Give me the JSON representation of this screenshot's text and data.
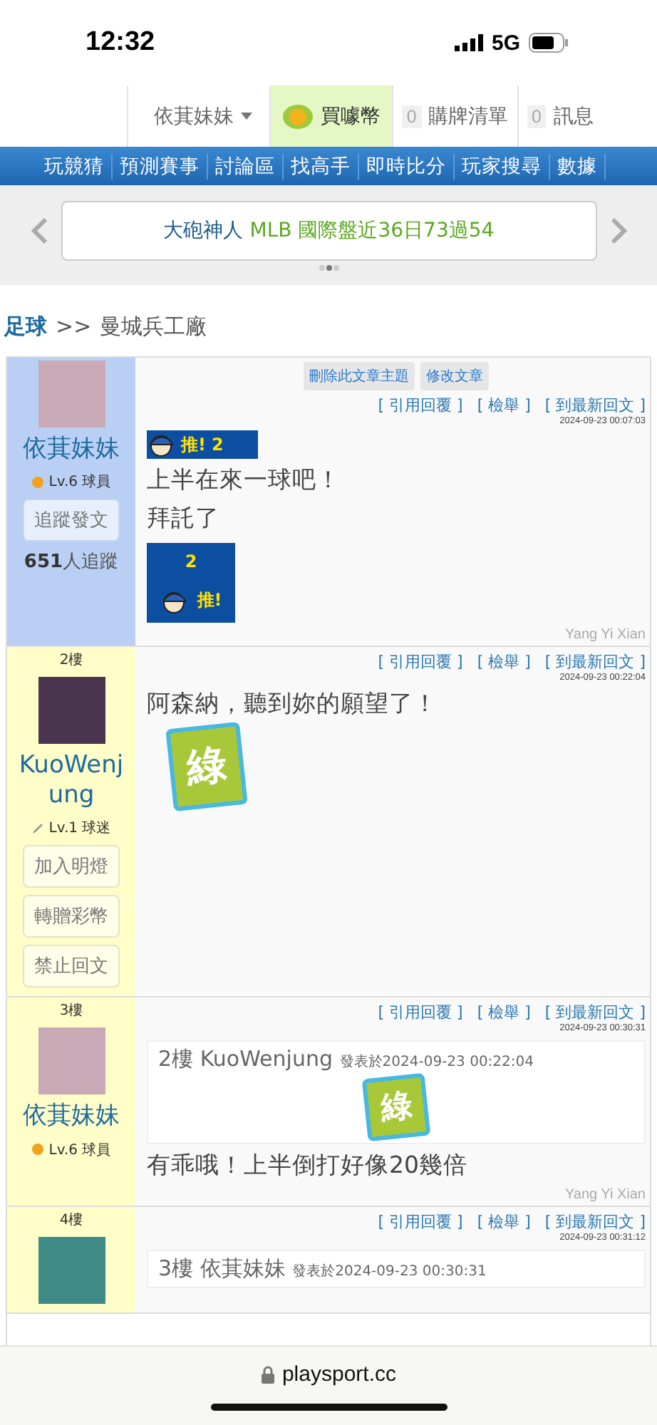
{
  "status_bar": {
    "time": "12:32",
    "network": "5G"
  },
  "top_nav": {
    "user_menu": "依萁妹妹",
    "buy_coins": "買噱幣",
    "cart": {
      "count": "0",
      "label": "購牌清單"
    },
    "messages": {
      "count": "0",
      "label": "訊息"
    }
  },
  "main_menu": [
    "玩競猜",
    "預測賽事",
    "討論區",
    "找高手",
    "即時比分",
    "玩家搜尋",
    "數據"
  ],
  "banner": {
    "name": "大砲神人",
    "record": "MLB 國際盤近36日73過54",
    "dots": [
      {
        "selected": false
      },
      {
        "selected": true
      },
      {
        "selected": false
      }
    ]
  },
  "breadcrumb": {
    "section": "足球",
    "separator": ">>",
    "topic": "曼城兵工廠"
  },
  "posts": [
    {
      "highlighted": true,
      "author": "依萁妹妹",
      "level": {
        "kind": "player",
        "text": "Lv.6 球員"
      },
      "side_buttons": [
        "追蹤發文"
      ],
      "followers": {
        "count": "651",
        "label": "人追蹤"
      },
      "admin_buttons": [
        "刪除此文章主題",
        "修改文章"
      ],
      "actions": [
        "[ 引用回覆 ]",
        "[ 檢舉 ]",
        "[ 到最新回文 ]"
      ],
      "timestamp": "2024-09-23 00:07:03",
      "body": [
        {
          "kind": "push-badge",
          "label": "推!",
          "count": "2"
        },
        {
          "kind": "text",
          "text": "上半在來一球吧！"
        },
        {
          "kind": "text",
          "text": "拜託了"
        },
        {
          "kind": "push-square",
          "label": "推!",
          "count": "2"
        }
      ],
      "signature": "Yang Yi Xian"
    },
    {
      "highlighted": false,
      "floor": "2樓",
      "author": "KuoWenjung",
      "level": {
        "kind": "fan",
        "text": "Lv.1 球迷"
      },
      "side_buttons": [
        "加入明燈",
        "轉贈彩幣",
        "禁止回文"
      ],
      "actions": [
        "[ 引用回覆 ]",
        "[ 檢舉 ]",
        "[ 到最新回文 ]"
      ],
      "timestamp": "2024-09-23 00:22:04",
      "body": [
        {
          "kind": "text",
          "text": "阿森納，聽到妳的願望了！"
        },
        {
          "kind": "sticker",
          "label": "綠"
        }
      ]
    },
    {
      "highlighted": false,
      "floor": "3樓",
      "author": "依萁妹妹",
      "level": {
        "kind": "player",
        "text": "Lv.6 球員"
      },
      "actions": [
        "[ 引用回覆 ]",
        "[ 檢舉 ]",
        "[ 到最新回文 ]"
      ],
      "timestamp": "2024-09-23 00:30:31",
      "body": [
        {
          "kind": "quote",
          "floor": "2樓",
          "author": "KuoWenjung",
          "posted": "發表於2024-09-23 00:22:04",
          "sticker": "綠"
        },
        {
          "kind": "text",
          "text": "有乖哦！上半倒打好像20幾倍"
        }
      ],
      "signature": "Yang Yi Xian"
    },
    {
      "highlighted": false,
      "floor": "4樓",
      "actions": [
        "[ 引用回覆 ]",
        "[ 檢舉 ]",
        "[ 到最新回文 ]"
      ],
      "timestamp": "2024-09-23 00:31:12",
      "body": [
        {
          "kind": "quote",
          "floor": "3樓",
          "author": "依萁妹妹",
          "posted": "發表於2024-09-23 00:30:31"
        }
      ]
    }
  ],
  "url_bar": {
    "url": "playsport.cc"
  }
}
